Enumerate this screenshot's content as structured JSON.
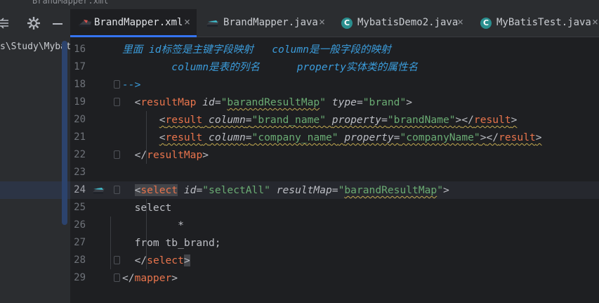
{
  "window": {
    "title": "BrandMapper.xml"
  },
  "tool_header": {
    "icons": [
      "collapse-all-icon",
      "gear-icon",
      "minimize-icon"
    ]
  },
  "tabs": [
    {
      "label": "BrandMapper.xml",
      "icon": "mybatis-xml-icon",
      "close": "×",
      "active": true
    },
    {
      "label": "BrandMapper.java",
      "icon": "mybatis-java-icon",
      "close": "×",
      "active": false
    },
    {
      "label": "MybatisDemo2.java",
      "icon": "java-class-icon",
      "close": "×",
      "active": false
    },
    {
      "label": "MyBatisTest.java",
      "icon": "java-class-icon",
      "close": "×",
      "active": false
    }
  ],
  "project": {
    "path": "s\\Study\\Mybat"
  },
  "editor": {
    "current_line": "24",
    "lines": [
      {
        "num": "16",
        "segments": [
          {
            "t": "里面 id标签是主键字段映射   column是一般字段的映射",
            "c": "t-com"
          }
        ]
      },
      {
        "num": "17",
        "segments": [
          {
            "t": "        column是表的列名      property实体类的属性名",
            "c": "t-com"
          }
        ]
      },
      {
        "num": "18",
        "segments": [
          {
            "t": "-->",
            "c": "t-com"
          }
        ]
      },
      {
        "num": "19",
        "segments": [
          {
            "t": "  <",
            "c": "t-bracket"
          },
          {
            "t": "resultMap",
            "c": "t-tagname"
          },
          {
            "t": " ",
            "c": "t-plain"
          },
          {
            "t": "id",
            "c": "t-attr"
          },
          {
            "t": "=",
            "c": "t-plain"
          },
          {
            "t": "\"",
            "c": "t-val"
          },
          {
            "t": "barandResultMap",
            "c": "t-val wavy"
          },
          {
            "t": "\"",
            "c": "t-val"
          },
          {
            "t": " ",
            "c": "t-plain"
          },
          {
            "t": "type",
            "c": "t-attr"
          },
          {
            "t": "=",
            "c": "t-plain"
          },
          {
            "t": "\"brand\"",
            "c": "t-val"
          },
          {
            "t": ">",
            "c": "t-bracket"
          }
        ]
      },
      {
        "num": "20",
        "segments": [
          {
            "t": "      ",
            "c": "t-plain"
          },
          {
            "t": "<result column=\"brand_name\" property=\"brandName\"></result>",
            "c": "t-mixed-20"
          }
        ]
      },
      {
        "num": "21",
        "segments": [
          {
            "t": "      ",
            "c": "t-plain"
          },
          {
            "t": "<result column=\"company_name\" property=\"companyName\"></result>",
            "c": "t-mixed-21"
          }
        ]
      },
      {
        "num": "22",
        "segments": [
          {
            "t": "  </",
            "c": "t-bracket"
          },
          {
            "t": "resultMap",
            "c": "t-tagname"
          },
          {
            "t": ">",
            "c": "t-bracket"
          }
        ]
      },
      {
        "num": "23",
        "segments": []
      },
      {
        "num": "24",
        "segments": [
          {
            "t": "  ",
            "c": "t-plain"
          },
          {
            "t": "<",
            "c": "t-bracket hl"
          },
          {
            "t": "select",
            "c": "t-tagname hl"
          },
          {
            "t": " ",
            "c": "t-plain"
          },
          {
            "t": "id",
            "c": "t-attr"
          },
          {
            "t": "=",
            "c": "t-plain"
          },
          {
            "t": "\"selectAll\"",
            "c": "t-val"
          },
          {
            "t": " ",
            "c": "t-plain"
          },
          {
            "t": "resultMap",
            "c": "t-attr"
          },
          {
            "t": "=",
            "c": "t-plain"
          },
          {
            "t": "\"",
            "c": "t-val"
          },
          {
            "t": "barandResultMap",
            "c": "t-val wavy"
          },
          {
            "t": "\"",
            "c": "t-val"
          },
          {
            "t": ">",
            "c": "t-bracket"
          }
        ]
      },
      {
        "num": "25",
        "segments": [
          {
            "t": "  select",
            "c": "t-plain"
          }
        ]
      },
      {
        "num": "26",
        "segments": [
          {
            "t": "         *",
            "c": "t-plain"
          }
        ]
      },
      {
        "num": "27",
        "segments": [
          {
            "t": "  from tb_brand;",
            "c": "t-plain"
          }
        ]
      },
      {
        "num": "28",
        "segments": [
          {
            "t": "  </",
            "c": "t-bracket"
          },
          {
            "t": "select",
            "c": "t-tagname"
          },
          {
            "t": ">",
            "c": "t-bracket hl"
          }
        ]
      },
      {
        "num": "29",
        "segments": [
          {
            "t": "</",
            "c": "t-bracket"
          },
          {
            "t": "mapper",
            "c": "t-tagname"
          },
          {
            "t": ">",
            "c": "t-bracket"
          }
        ]
      }
    ]
  },
  "colors": {
    "accent": "#3574f0",
    "comment": "#3b9cdb",
    "tag": "#e8744c",
    "string": "#6aab73",
    "warning_underline": "#c2a94f"
  }
}
